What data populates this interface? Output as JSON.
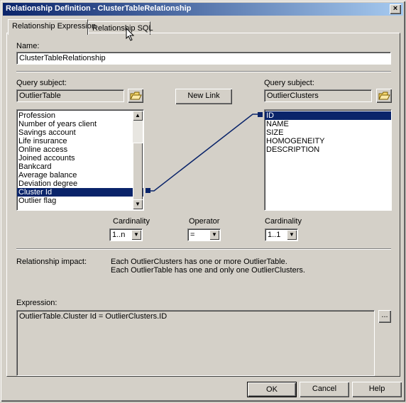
{
  "window": {
    "title": "Relationship Definition - ClusterTableRelationship",
    "close_label": "×"
  },
  "tabs": [
    {
      "label": "Relationship Expression",
      "active": true
    },
    {
      "label": "Relationship SQL",
      "active": false
    }
  ],
  "name": {
    "label": "Name:",
    "value": "ClusterTableRelationship"
  },
  "left": {
    "query_label": "Query subject:",
    "query_value": "OutlierTable",
    "items": [
      "Profession",
      "Number of years client",
      "Savings account",
      "Life insurance",
      "Online access",
      "Joined accounts",
      "Bankcard",
      "Average balance",
      "Deviation degree",
      "Cluster Id",
      "Outlier flag"
    ],
    "selected": "Cluster Id"
  },
  "right": {
    "query_label": "Query subject:",
    "query_value": "OutlierClusters",
    "items": [
      "ID",
      "NAME",
      "SIZE",
      "HOMOGENEITY",
      "DESCRIPTION"
    ],
    "selected": "ID"
  },
  "new_link_label": "New Link",
  "cardinality_left": {
    "label": "Cardinality",
    "value": "1..n"
  },
  "operator": {
    "label": "Operator",
    "value": "="
  },
  "cardinality_right": {
    "label": "Cardinality",
    "value": "1..1"
  },
  "impact": {
    "label": "Relationship impact:",
    "line1": "Each OutlierClusters has one or more OutlierTable.",
    "line2": "Each OutlierTable has one and only one OutlierClusters."
  },
  "expression": {
    "label": "Expression:",
    "value": "OutlierTable.Cluster Id = OutlierClusters.ID",
    "ellipsis_label": "..."
  },
  "footer": {
    "ok": "OK",
    "cancel": "Cancel",
    "help": "Help"
  },
  "colors": {
    "selection": "#0a246a",
    "title_start": "#0a246a",
    "title_end": "#a6caf0"
  },
  "icons": [
    "close-icon",
    "folder-open-icon",
    "scroll-up-icon",
    "scroll-down-icon",
    "dropdown-arrow-icon"
  ]
}
